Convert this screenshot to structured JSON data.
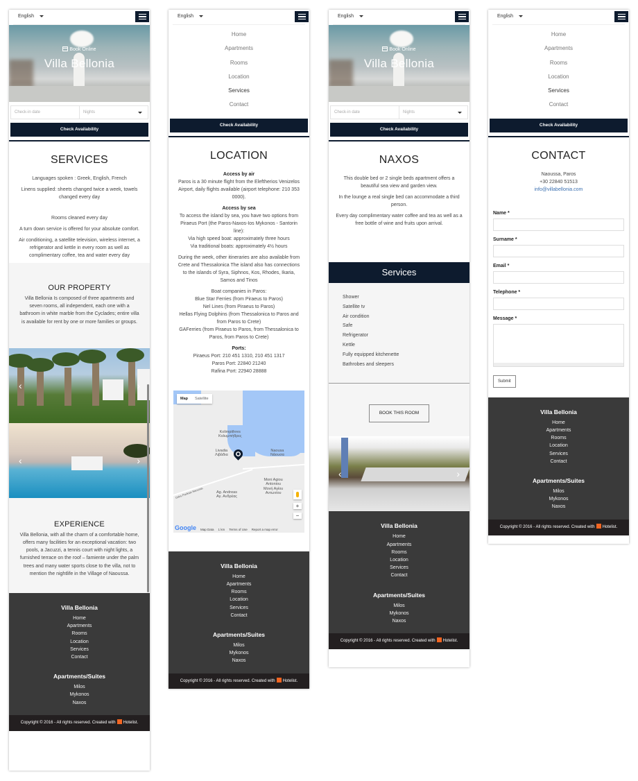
{
  "common": {
    "language": "English",
    "check_availability": "Check Availability",
    "menu_icon": "hamburger-menu-icon",
    "brand_color": "#0d1b2e",
    "nav_items": [
      "Home",
      "Apartments",
      "Rooms",
      "Location",
      "Services",
      "Contact"
    ],
    "active_nav": "Services",
    "footer": {
      "title": "Villa Bellonia",
      "links": [
        "Home",
        "Apartments",
        "Rooms",
        "Location",
        "Services",
        "Contact"
      ],
      "suites_title": "Apartments/Suites",
      "suites": [
        "Milos",
        "Mykonos",
        "Naxos"
      ],
      "copyright_prefix": "Copyright © 2016 - All rights reserved. Created with",
      "copyright_brand": "Hotelist.",
      "hotelist_icon_color": "#f26522"
    }
  },
  "hero": {
    "book_online": "Book Online",
    "title": "Villa Bellonia",
    "checkin_placeholder": "Check-in date",
    "nights_placeholder": "Nights"
  },
  "services_page": {
    "title": "SERVICES",
    "paragraphs": [
      "Languages spoken : Greek, English, French",
      "Linens supplied: sheets changed twice a week, towels changed every day",
      "Rooms cleaned every day",
      "A turn down service is offered for your absolute comfort.",
      "Air conditioning, a satellite television, wireless internet, a refrigerator and kettle in every room as well as complimentary coffee, tea and water every day"
    ],
    "property": {
      "title": "OUR PROPERTY",
      "text": "Villa Bellonia Is composed of three apartments and seven rooms, all independent, each one with a bathroom in white marble from the Cyclades; entire villa is available for rent by one or more families or groups."
    },
    "experience": {
      "title": "EXPERIENCE",
      "text": "Villa Bellonia, with all the charm of a comfortable home, offers many facilities for an exceptional vacation: two pools, a Jacuzzi, a tennis court with night lights, a furnished terrace on the roof – famiente under the palm trees and many water sports close to the villa, not to mention the nightlife in the Village of Naoussa."
    }
  },
  "location_page": {
    "title": "LOCATION",
    "air_heading": "Access by air",
    "air_text": "Paros is a 30 minute flight from the Eleftherios Venizelos Airport, daily flights available (airport telephone: 210 353 0000).",
    "sea_heading": "Access by sea",
    "sea_lines": [
      "To access the island by sea, you have two options from Piraeus Port (the Paros-Naxos-Ios Mykonos - Santorin line):",
      "Via high speed boat: approximately three hours",
      "Via traditional boats: approximately 4½ hours"
    ],
    "itineraries": "During the week, other itineraries are also available from Crete and Thessalonica The island also has connections to the islands of Syra, Siphnos, Kos, Rhodes, Ikaria, Samos and Tinos",
    "boats": [
      "Boat companies in Paros:",
      "Blue Star Ferries (from Piraeus to Paros)",
      "Nel Lines (from Piraeus to Paros)",
      "Hellas Flying Dolphins (from Thessalonica to Paros and from Paros to Crete)",
      "GAFerries (from Piraeus to Paros, from Thessalonica to Paros, from Paros to Crete)"
    ],
    "ports_heading": "Ports:",
    "ports": [
      "Piraeus Port: 210 451 1310, 210 451 1317",
      "Paros Port: 22840 21240",
      "Rafina Port: 22940 28888"
    ],
    "map": {
      "tab_map": "Map",
      "tab_satellite": "Satellite",
      "labels": {
        "kolimpithres": "Kolimpithres\nΚολυμπήθρες",
        "livadia": "Livadia\nΛιβάδια",
        "naousa": "Naousa\nΝάουσα",
        "moni": "Moni Agiou\nAntoniou\nΜονή Αγίου\nΑντωνίου",
        "andreas": "Ag. Andreas\nΑγ. Ανδρέας",
        "road": "Odos Parikias Naousas"
      },
      "google": "Google",
      "map_data": "Map Data",
      "scale": "1 km",
      "terms": "Terms of Use",
      "report": "Report a map error",
      "zoom_in": "+",
      "zoom_out": "−"
    }
  },
  "naxos_page": {
    "title": "NAXOS",
    "paragraphs": [
      "This double bed or 2 single beds apartment offers a beautiful sea view and garden view.",
      "In the lounge a real single bed can accommodate a third person.",
      "Every day complimentary water coffee and tea as well as a free bottle of wine and fruits upon arrival."
    ],
    "services_band": "Services",
    "amenities": [
      "Shower",
      "Satellite tv",
      "Air condition",
      "Safe",
      "Refrigerator",
      "Kettle",
      "Fully equipped kitchenette",
      "Bathrobes and sleepers"
    ],
    "book_button": "BOOK THIS ROOM"
  },
  "contact_page": {
    "title": "CONTACT",
    "address": "Naoussa, Paros",
    "phone": "+30 22840 51513",
    "email": "info@villabellonia.com",
    "fields": {
      "name": "Name *",
      "surname": "Surname *",
      "email": "Email *",
      "telephone": "Telephone *",
      "message": "Message *"
    },
    "submit": "Submit"
  }
}
